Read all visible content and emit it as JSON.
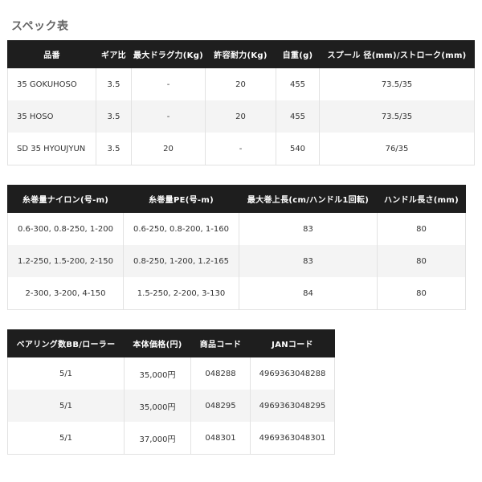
{
  "page_title": "スペック表",
  "table1": {
    "headers": [
      "品番",
      "ギア比",
      "最大ドラグ力(Kg)",
      "許容耐力(Kg)",
      "自重(g)",
      "スプール 径(mm)/ストローク(mm)"
    ],
    "rows": [
      [
        "35 GOKUHOSO",
        "3.5",
        "-",
        "20",
        "455",
        "73.5/35"
      ],
      [
        "35 HOSO",
        "3.5",
        "-",
        "20",
        "455",
        "73.5/35"
      ],
      [
        "SD 35 HYOUJYUN",
        "3.5",
        "20",
        "-",
        "540",
        "76/35"
      ]
    ]
  },
  "table2": {
    "headers": [
      "糸巻量ナイロン(号-m)",
      "糸巻量PE(号-m)",
      "最大巻上長(cm/ハンドル1回転)",
      "ハンドル長さ(mm)"
    ],
    "rows": [
      [
        "0.6-300, 0.8-250, 1-200",
        "0.6-250, 0.8-200, 1-160",
        "83",
        "80"
      ],
      [
        "1.2-250, 1.5-200, 2-150",
        "0.8-250, 1-200, 1.2-165",
        "83",
        "80"
      ],
      [
        "2-300, 3-200, 4-150",
        "1.5-250, 2-200, 3-130",
        "84",
        "80"
      ]
    ]
  },
  "table3": {
    "headers": [
      "ベアリング数BB/ローラー",
      "本体価格(円)",
      "商品コード",
      "JANコード"
    ],
    "rows": [
      [
        "5/1",
        "35,000円",
        "048288",
        "4969363048288"
      ],
      [
        "5/1",
        "35,000円",
        "048295",
        "4969363048295"
      ],
      [
        "5/1",
        "37,000円",
        "048301",
        "4969363048301"
      ]
    ]
  }
}
